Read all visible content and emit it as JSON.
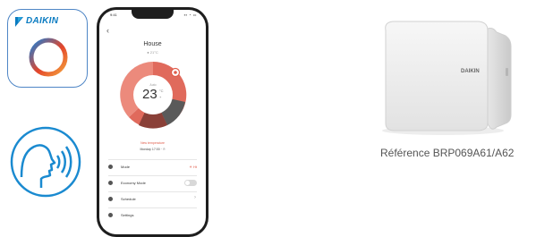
{
  "app_icon": {
    "brand": "DAIKIN",
    "brand_color": "#0a7bc1",
    "ring_colors": [
      "#1a7ed6",
      "#e3452b",
      "#f4a23c"
    ]
  },
  "voice_icon": {
    "icon": "voice-assistant-icon",
    "color": "#1a8ad0"
  },
  "phone": {
    "status": {
      "time": "9:41",
      "icons": "▪▪ ◔ ▭"
    },
    "back_icon": "‹",
    "title": "House",
    "subtitle": "● 21°C",
    "dial": {
      "label": "Auto",
      "temperature": "23",
      "degree": "°C",
      "unit": "+"
    },
    "schedule_note": "New temperature",
    "schedule_time": "Monday 17:00 · ⏱",
    "menu": [
      {
        "label": "Mode",
        "value": "☀ Ht"
      },
      {
        "label": "Economy Mode",
        "toggle": false
      },
      {
        "label": "Schedule",
        "chevron": "›"
      },
      {
        "label": "Settings",
        "chevron": ""
      }
    ],
    "accent_color": "#e05c4a"
  },
  "device": {
    "brand": "DAIKIN",
    "body_color": "#f2f2f2"
  },
  "caption": "Référence BRP069A61/A62"
}
